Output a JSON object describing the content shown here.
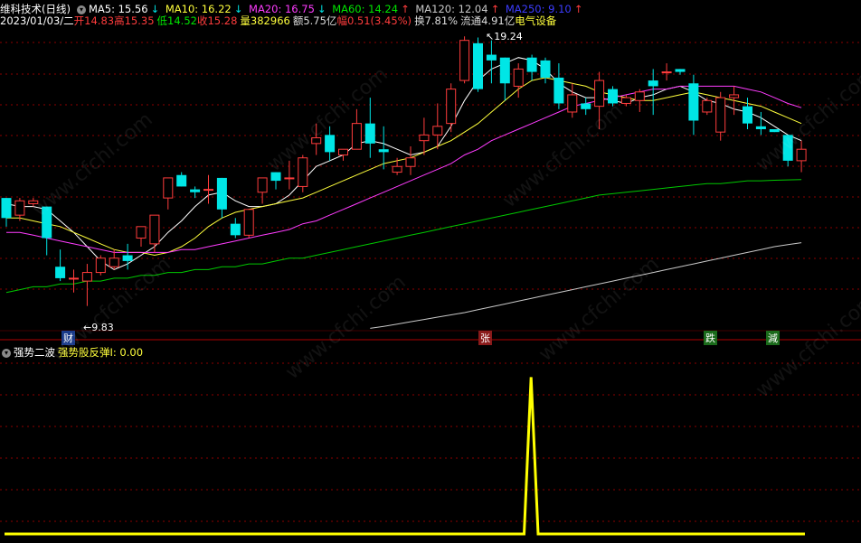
{
  "header": {
    "stock_name": "维科技术(日线)",
    "ma5": "MA5: 15.56",
    "ma10": "MA10: 16.22",
    "ma20": "MA20: 16.75",
    "ma60": "MA60: 14.24",
    "ma120": "MA120: 12.04",
    "ma250": "MA250: 9.10",
    "date": "2023/01/03/二",
    "open_label": "开",
    "open": "14.83",
    "high_label": "高",
    "high": "15.35",
    "low_label": "低",
    "low": "14.52",
    "close_label": "收",
    "close": "15.28",
    "vol_label": "量",
    "vol": "382966",
    "amt_label": "额",
    "amt": "5.75亿",
    "chg_label": "幅",
    "chg": "0.51(3.45%)",
    "turn": "换7.81%",
    "float": "流通4.91亿",
    "sector": "电气设备"
  },
  "colors": {
    "up": "#ff3c3c",
    "down": "#00e6e6",
    "ma5": "#ffffff",
    "ma10": "#ffff3c",
    "ma20": "#ff3cff",
    "ma60": "#00c800",
    "ma120": "#c8c8c8",
    "indicator": "#ffff00",
    "grid": "#8b0000"
  },
  "annotations": {
    "high_label": "19.24",
    "low_label": "9.83",
    "markers": [
      "财",
      "张",
      "跌",
      "減"
    ]
  },
  "indicator_panel": {
    "title": "强势二波",
    "series_label": "强势股反弹I: 0.00"
  },
  "footer_text": "",
  "chart_data": [
    {
      "type": "candlestick",
      "ylim": [
        9,
        19.5
      ],
      "ohlc": [
        [
          13.6,
          13.6,
          12.6,
          12.9
        ],
        [
          13.0,
          13.6,
          12.8,
          13.5
        ],
        [
          13.4,
          13.6,
          13.3,
          13.5
        ],
        [
          13.3,
          13.3,
          11.6,
          12.2
        ],
        [
          11.2,
          11.8,
          10.7,
          10.8
        ],
        [
          10.8,
          11.1,
          10.3,
          10.8
        ],
        [
          10.7,
          11.3,
          9.83,
          11.0
        ],
        [
          11.0,
          11.6,
          10.9,
          11.5
        ],
        [
          11.2,
          11.8,
          11.1,
          11.5
        ],
        [
          11.6,
          12.0,
          11.1,
          11.4
        ],
        [
          12.2,
          12.6,
          11.9,
          12.6
        ],
        [
          12.0,
          13.0,
          11.7,
          13.0
        ],
        [
          13.6,
          14.3,
          13.2,
          14.3
        ],
        [
          14.4,
          14.5,
          14.0,
          14.0
        ],
        [
          13.9,
          14.0,
          13.6,
          13.8
        ],
        [
          13.9,
          14.4,
          13.4,
          13.9
        ],
        [
          14.3,
          14.3,
          12.9,
          13.2
        ],
        [
          12.7,
          12.9,
          12.2,
          12.3
        ],
        [
          12.3,
          13.2,
          12.2,
          13.2
        ],
        [
          13.8,
          14.3,
          13.4,
          14.3
        ],
        [
          14.5,
          14.5,
          13.9,
          14.2
        ],
        [
          14.3,
          14.9,
          13.9,
          14.3
        ],
        [
          14.0,
          15.1,
          13.8,
          15.0
        ],
        [
          15.5,
          16.2,
          15.1,
          15.7
        ],
        [
          15.8,
          16.1,
          14.9,
          15.2
        ],
        [
          15.1,
          15.3,
          14.9,
          15.3
        ],
        [
          15.3,
          16.7,
          15.3,
          16.2
        ],
        [
          16.2,
          17.1,
          15.0,
          15.5
        ],
        [
          15.3,
          16.1,
          14.6,
          15.2
        ],
        [
          14.5,
          15.0,
          14.4,
          14.7
        ],
        [
          14.7,
          15.4,
          14.4,
          15.0
        ],
        [
          15.6,
          16.4,
          15.1,
          15.8
        ],
        [
          15.8,
          16.9,
          15.3,
          16.1
        ],
        [
          16.2,
          17.6,
          15.9,
          17.4
        ],
        [
          17.7,
          19.24,
          17.6,
          19.1
        ],
        [
          19.0,
          19.2,
          17.3,
          17.4
        ],
        [
          18.6,
          19.1,
          17.6,
          18.4
        ],
        [
          18.5,
          18.5,
          17.0,
          17.6
        ],
        [
          17.5,
          18.3,
          17.1,
          18.1
        ],
        [
          18.5,
          18.6,
          17.7,
          18.0
        ],
        [
          18.4,
          18.5,
          17.6,
          17.8
        ],
        [
          17.8,
          18.3,
          16.7,
          16.9
        ],
        [
          16.6,
          17.6,
          16.4,
          17.2
        ],
        [
          16.9,
          17.1,
          16.5,
          16.7
        ],
        [
          16.8,
          18.0,
          16.0,
          17.7
        ],
        [
          17.4,
          17.5,
          16.8,
          16.9
        ],
        [
          16.9,
          17.2,
          16.8,
          17.1
        ],
        [
          17.0,
          17.4,
          16.6,
          17.3
        ],
        [
          17.7,
          18.1,
          16.5,
          17.5
        ],
        [
          18.0,
          18.3,
          17.7,
          18.0
        ],
        [
          18.1,
          18.1,
          17.9,
          18.0
        ],
        [
          17.6,
          17.9,
          15.8,
          16.3
        ],
        [
          16.6,
          17.1,
          16.5,
          17.0
        ],
        [
          15.9,
          17.3,
          15.6,
          17.1
        ],
        [
          17.1,
          17.5,
          16.5,
          17.2
        ],
        [
          16.8,
          17.1,
          16.0,
          16.2
        ],
        [
          16.1,
          16.6,
          15.8,
          16.0
        ],
        [
          16.0,
          16.0,
          15.9,
          15.9
        ],
        [
          15.8,
          15.8,
          14.7,
          14.9
        ],
        [
          14.9,
          15.6,
          14.5,
          15.3
        ]
      ],
      "series": [
        {
          "name": "MA5",
          "values": [
            13.4,
            13.3,
            13.3,
            13.2,
            12.8,
            12.4,
            11.9,
            11.4,
            11.1,
            11.3,
            11.6,
            11.9,
            12.4,
            12.8,
            13.3,
            13.7,
            13.8,
            13.5,
            13.3,
            13.3,
            13.4,
            13.7,
            14.2,
            14.7,
            14.9,
            15.1,
            15.5,
            15.6,
            15.5,
            15.3,
            15.1,
            15.2,
            15.4,
            16.1,
            17.0,
            17.7,
            18.1,
            18.3,
            18.5,
            18.4,
            18.1,
            17.6,
            17.3,
            17.1,
            17.1,
            17.0,
            16.9,
            17.1,
            17.2,
            17.4,
            17.5,
            17.3,
            17.0,
            16.9,
            16.7,
            16.6,
            16.4,
            16.1,
            15.8,
            15.6
          ]
        },
        {
          "name": "MA10",
          "values": [
            12.9,
            12.9,
            12.8,
            12.7,
            12.6,
            12.4,
            12.2,
            12.0,
            11.8,
            11.7,
            11.7,
            11.6,
            11.7,
            11.9,
            12.2,
            12.6,
            12.9,
            13.1,
            13.2,
            13.3,
            13.4,
            13.5,
            13.6,
            13.8,
            14.0,
            14.2,
            14.4,
            14.6,
            14.8,
            14.9,
            15.0,
            15.2,
            15.4,
            15.6,
            15.9,
            16.2,
            16.6,
            17.0,
            17.4,
            17.7,
            17.8,
            17.7,
            17.6,
            17.5,
            17.3,
            17.2,
            17.1,
            17.0,
            17.0,
            17.1,
            17.2,
            17.3,
            17.2,
            17.1,
            17.0,
            16.9,
            16.8,
            16.6,
            16.4,
            16.2
          ]
        },
        {
          "name": "MA20",
          "values": [
            12.4,
            12.4,
            12.3,
            12.2,
            12.1,
            12.0,
            11.9,
            11.8,
            11.7,
            11.7,
            11.7,
            11.7,
            11.7,
            11.8,
            11.8,
            11.9,
            12.0,
            12.1,
            12.2,
            12.3,
            12.4,
            12.5,
            12.7,
            12.8,
            13.0,
            13.2,
            13.4,
            13.6,
            13.8,
            14.0,
            14.2,
            14.4,
            14.6,
            14.8,
            15.1,
            15.3,
            15.6,
            15.8,
            16.0,
            16.2,
            16.4,
            16.6,
            16.8,
            16.9,
            17.0,
            17.1,
            17.2,
            17.3,
            17.4,
            17.4,
            17.5,
            17.5,
            17.5,
            17.5,
            17.5,
            17.4,
            17.3,
            17.1,
            16.9,
            16.75
          ]
        },
        {
          "name": "MA60",
          "values": [
            10.3,
            10.4,
            10.5,
            10.5,
            10.6,
            10.6,
            10.7,
            10.7,
            10.8,
            10.8,
            10.9,
            10.9,
            11.0,
            11.0,
            11.1,
            11.1,
            11.2,
            11.2,
            11.3,
            11.3,
            11.4,
            11.5,
            11.5,
            11.6,
            11.7,
            11.8,
            11.9,
            12.0,
            12.1,
            12.2,
            12.3,
            12.4,
            12.5,
            12.6,
            12.7,
            12.8,
            12.9,
            13.0,
            13.1,
            13.2,
            13.3,
            13.4,
            13.5,
            13.6,
            13.7,
            13.75,
            13.8,
            13.85,
            13.9,
            13.95,
            14.0,
            14.05,
            14.1,
            14.1,
            14.15,
            14.2,
            14.2,
            14.22,
            14.23,
            14.24
          ]
        },
        {
          "name": "MA120",
          "values": [
            null,
            null,
            null,
            null,
            null,
            null,
            null,
            null,
            null,
            null,
            null,
            null,
            null,
            null,
            null,
            null,
            null,
            null,
            null,
            null,
            null,
            null,
            null,
            null,
            null,
            null,
            null,
            9.05,
            9.12,
            9.2,
            9.28,
            9.36,
            9.44,
            9.52,
            9.6,
            9.7,
            9.8,
            9.9,
            10.0,
            10.1,
            10.2,
            10.3,
            10.4,
            10.5,
            10.6,
            10.7,
            10.8,
            10.9,
            11.0,
            11.1,
            11.2,
            11.3,
            11.4,
            11.5,
            11.6,
            11.7,
            11.8,
            11.9,
            11.97,
            12.04
          ]
        }
      ]
    },
    {
      "type": "line",
      "series": [
        {
          "name": "强势股反弹I",
          "values": [
            0,
            0,
            0,
            0,
            0,
            0,
            0,
            0,
            0,
            0,
            0,
            0,
            0,
            0,
            0,
            0,
            0,
            0,
            0,
            0,
            0,
            0,
            0,
            0,
            0,
            0,
            0,
            0,
            0,
            0,
            0,
            0,
            0,
            0,
            0,
            0,
            0,
            0,
            0,
            0,
            0,
            0,
            0,
            0,
            0,
            0,
            0,
            0,
            0,
            0,
            0,
            0,
            0,
            0,
            0,
            0,
            0,
            0,
            0,
            0,
            0,
            0,
            0,
            0,
            0,
            0,
            0,
            0,
            0,
            0,
            0,
            0,
            0,
            0,
            0,
            1,
            0,
            0,
            0,
            0,
            0,
            0,
            0,
            0,
            0,
            0,
            0,
            0,
            0,
            0,
            0,
            0,
            0,
            0,
            0,
            0,
            0,
            0,
            0,
            0,
            0,
            0,
            0,
            0,
            0,
            0,
            0,
            0,
            0,
            0,
            0,
            0,
            0,
            0,
            0
          ]
        }
      ],
      "ylim": [
        0,
        1.1
      ]
    }
  ]
}
